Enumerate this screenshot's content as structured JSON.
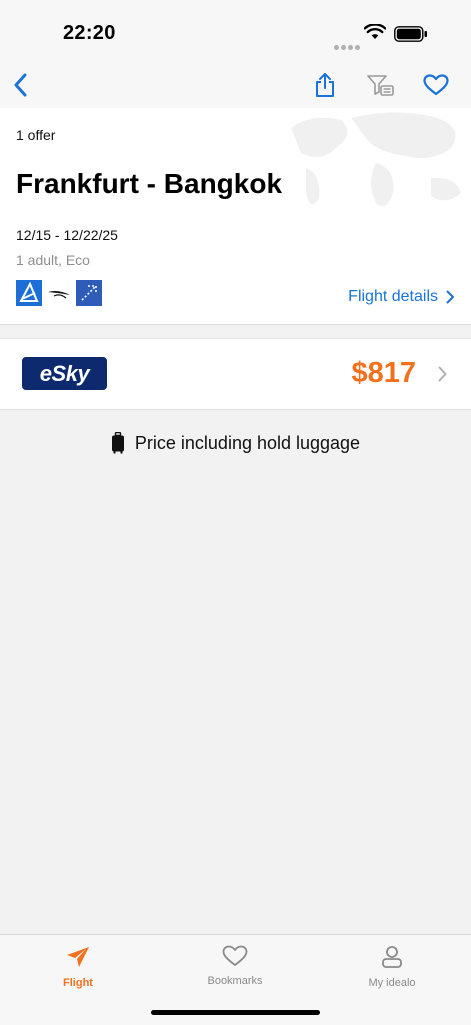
{
  "status": {
    "time": "22:20"
  },
  "nav": {
    "back_icon": "chevron-left-icon",
    "share_icon": "share-icon",
    "filter_icon": "filter-icon",
    "favorite_icon": "heart-icon",
    "accent_color": "#1a73d9"
  },
  "header": {
    "offer_count": "1 offer",
    "route": "Frankfurt - Bangkok",
    "dates": "12/15 - 12/22/25",
    "passengers": "1 adult, Eco",
    "airlines": [
      "airline-logo-1",
      "airline-logo-2",
      "airline-logo-3"
    ],
    "details_label": "Flight details"
  },
  "offer": {
    "provider": "eSky",
    "price": "$817",
    "price_color": "#f2711c"
  },
  "luggage_note": "Price including hold luggage",
  "tabbar": {
    "tabs": [
      {
        "label": "Flight",
        "icon": "airplane-icon",
        "active": true
      },
      {
        "label": "Bookmarks",
        "icon": "heart-icon",
        "active": false
      },
      {
        "label": "My idealo",
        "icon": "user-icon",
        "active": false
      }
    ]
  }
}
